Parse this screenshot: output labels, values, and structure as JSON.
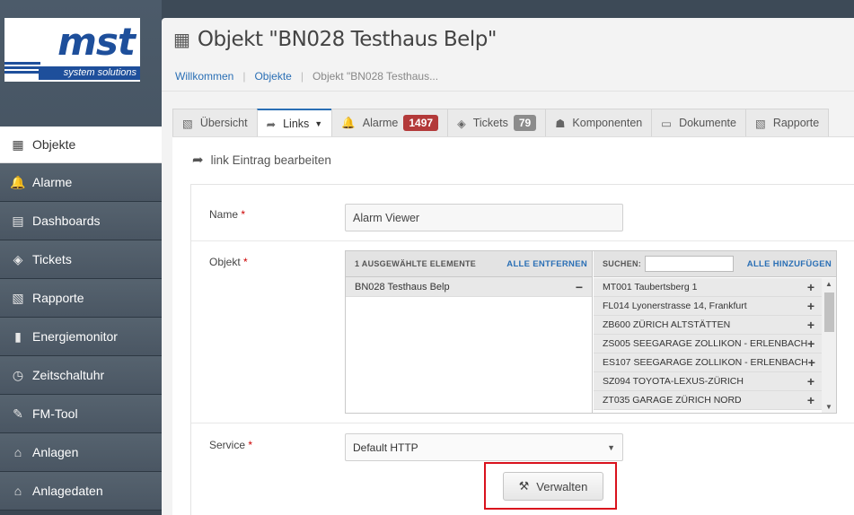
{
  "logo": {
    "main": "mst",
    "sub": "system solutions"
  },
  "sidebar": {
    "items": [
      {
        "label": "Objekte",
        "icon": "building-icon",
        "glyph": "▦",
        "active": true
      },
      {
        "label": "Alarme",
        "icon": "bell-icon",
        "glyph": "🔔"
      },
      {
        "label": "Dashboards",
        "icon": "dashboard-icon",
        "glyph": "▤"
      },
      {
        "label": "Tickets",
        "icon": "ticket-icon",
        "glyph": "◈"
      },
      {
        "label": "Rapporte",
        "icon": "report-icon",
        "glyph": "▧"
      },
      {
        "label": "Energiemonitor",
        "icon": "bar-chart-icon",
        "glyph": "▮"
      },
      {
        "label": "Zeitschaltuhr",
        "icon": "clock-icon",
        "glyph": "◷"
      },
      {
        "label": "FM-Tool",
        "icon": "wrench-icon",
        "glyph": "✎"
      },
      {
        "label": "Anlagen",
        "icon": "plant-icon",
        "glyph": "⌂"
      },
      {
        "label": "Anlagedaten",
        "icon": "plant-data-icon",
        "glyph": "⌂"
      }
    ]
  },
  "header": {
    "title": "Objekt \"BN028 Testhaus Belp\"",
    "icon_glyph": "▦"
  },
  "breadcrumb": {
    "home": "Willkommen",
    "parent": "Objekte",
    "current": "Objekt \"BN028 Testhaus..."
  },
  "tabs": [
    {
      "label": "Übersicht",
      "glyph": "▧"
    },
    {
      "label": "Links",
      "glyph": "➦",
      "active": true,
      "caret": "▼"
    },
    {
      "label": "Alarme",
      "glyph": "🔔",
      "badge": "1497"
    },
    {
      "label": "Tickets",
      "glyph": "◈",
      "badge": "79"
    },
    {
      "label": "Komponenten",
      "glyph": "☗"
    },
    {
      "label": "Dokumente",
      "glyph": "▭"
    },
    {
      "label": "Rapporte",
      "glyph": "▧"
    }
  ],
  "form": {
    "section_title": "link Eintrag bearbeiten",
    "section_glyph": "➦",
    "name_label": "Name",
    "name_value": "Alarm Viewer",
    "required_mark": "*",
    "object_label": "Objekt",
    "selected_header": "1 AUSGEWÄHLTE ELEMENTE",
    "remove_all": "ALLE ENTFERNEN",
    "search_label": "SUCHEN:",
    "add_all": "ALLE HINZUFÜGEN",
    "selected_items": [
      "BN028 Testhaus Belp"
    ],
    "available_items": [
      "MT001 Taubertsberg 1",
      "FL014 Lyonerstrasse 14, Frankfurt",
      "ZB600 ZÜRICH ALTSTÄTTEN",
      "ZS005 SEEGARAGE ZOLLIKON - ERLENBACH",
      "ES107 SEEGARAGE ZOLLIKON - ERLENBACH",
      "SZ094 TOYOTA-LEXUS-ZÜRICH",
      "ZT035 GARAGE ZÜRICH NORD"
    ],
    "service_label": "Service",
    "service_value": "Default HTTP",
    "manage_button": "Verwalten",
    "manage_glyph": "⚒"
  }
}
